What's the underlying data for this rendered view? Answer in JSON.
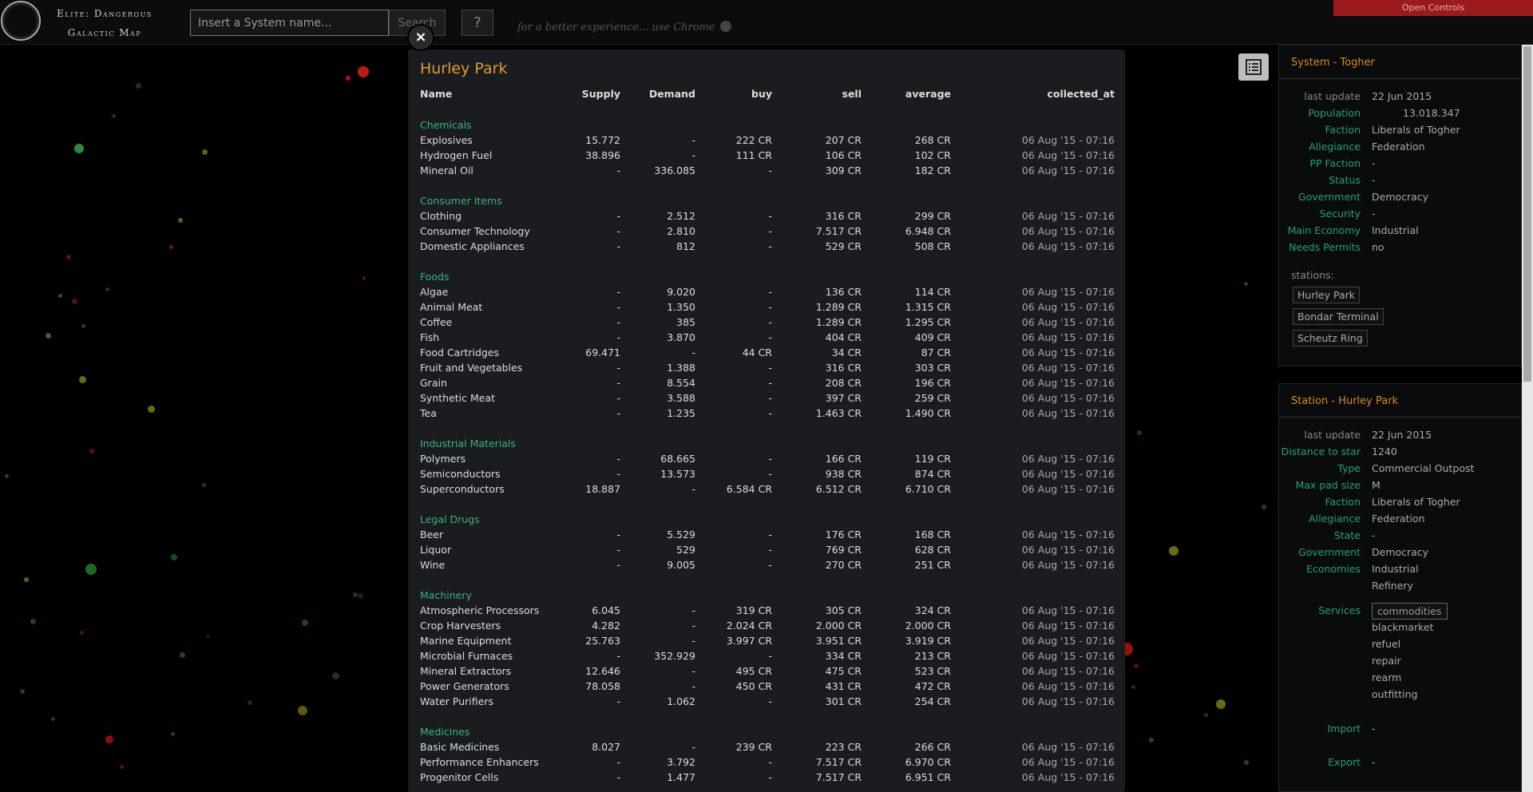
{
  "app": {
    "title_line1": "Elite: Dangerous",
    "title_line2": "Galactic Map"
  },
  "search": {
    "placeholder": "Insert a System name...",
    "button": "Search"
  },
  "help": {
    "label": "?"
  },
  "hint": {
    "text": "for a better experience... use Chrome"
  },
  "open_controls": "Open Controls",
  "close_label": "×",
  "market": {
    "station": "Hurley Park",
    "columns": [
      "Name",
      "Supply",
      "Demand",
      "buy",
      "sell",
      "average",
      "collected_at"
    ],
    "categories": [
      {
        "name": "Chemicals",
        "items": [
          [
            "Explosives",
            "15.772",
            "-",
            "222 CR",
            "207 CR",
            "268 CR",
            "06 Aug '15 - 07:16"
          ],
          [
            "Hydrogen Fuel",
            "38.896",
            "-",
            "111 CR",
            "106 CR",
            "102 CR",
            "06 Aug '15 - 07:16"
          ],
          [
            "Mineral Oil",
            "-",
            "336.085",
            "-",
            "309 CR",
            "182 CR",
            "06 Aug '15 - 07:16"
          ]
        ]
      },
      {
        "name": "Consumer Items",
        "items": [
          [
            "Clothing",
            "-",
            "2.512",
            "-",
            "316 CR",
            "299 CR",
            "06 Aug '15 - 07:16"
          ],
          [
            "Consumer Technology",
            "-",
            "2.810",
            "-",
            "7.517 CR",
            "6.948 CR",
            "06 Aug '15 - 07:16"
          ],
          [
            "Domestic Appliances",
            "-",
            "812",
            "-",
            "529 CR",
            "508 CR",
            "06 Aug '15 - 07:16"
          ]
        ]
      },
      {
        "name": "Foods",
        "items": [
          [
            "Algae",
            "-",
            "9.020",
            "-",
            "136 CR",
            "114 CR",
            "06 Aug '15 - 07:16"
          ],
          [
            "Animal Meat",
            "-",
            "1.350",
            "-",
            "1.289 CR",
            "1.315 CR",
            "06 Aug '15 - 07:16"
          ],
          [
            "Coffee",
            "-",
            "385",
            "-",
            "1.289 CR",
            "1.295 CR",
            "06 Aug '15 - 07:16"
          ],
          [
            "Fish",
            "-",
            "3.870",
            "-",
            "404 CR",
            "409 CR",
            "06 Aug '15 - 07:16"
          ],
          [
            "Food Cartridges",
            "69.471",
            "-",
            "44 CR",
            "34 CR",
            "87 CR",
            "06 Aug '15 - 07:16"
          ],
          [
            "Fruit and Vegetables",
            "-",
            "1.388",
            "-",
            "316 CR",
            "303 CR",
            "06 Aug '15 - 07:16"
          ],
          [
            "Grain",
            "-",
            "8.554",
            "-",
            "208 CR",
            "196 CR",
            "06 Aug '15 - 07:16"
          ],
          [
            "Synthetic Meat",
            "-",
            "3.588",
            "-",
            "397 CR",
            "259 CR",
            "06 Aug '15 - 07:16"
          ],
          [
            "Tea",
            "-",
            "1.235",
            "-",
            "1.463 CR",
            "1.490 CR",
            "06 Aug '15 - 07:16"
          ]
        ]
      },
      {
        "name": "Industrial Materials",
        "items": [
          [
            "Polymers",
            "-",
            "68.665",
            "-",
            "166 CR",
            "119 CR",
            "06 Aug '15 - 07:16"
          ],
          [
            "Semiconductors",
            "-",
            "13.573",
            "-",
            "938 CR",
            "874 CR",
            "06 Aug '15 - 07:16"
          ],
          [
            "Superconductors",
            "18.887",
            "-",
            "6.584 CR",
            "6.512 CR",
            "6.710 CR",
            "06 Aug '15 - 07:16"
          ]
        ]
      },
      {
        "name": "Legal Drugs",
        "items": [
          [
            "Beer",
            "-",
            "5.529",
            "-",
            "176 CR",
            "168 CR",
            "06 Aug '15 - 07:16"
          ],
          [
            "Liquor",
            "-",
            "529",
            "-",
            "769 CR",
            "628 CR",
            "06 Aug '15 - 07:16"
          ],
          [
            "Wine",
            "-",
            "9.005",
            "-",
            "270 CR",
            "251 CR",
            "06 Aug '15 - 07:16"
          ]
        ]
      },
      {
        "name": "Machinery",
        "items": [
          [
            "Atmospheric Processors",
            "6.045",
            "-",
            "319 CR",
            "305 CR",
            "324 CR",
            "06 Aug '15 - 07:16"
          ],
          [
            "Crop Harvesters",
            "4.282",
            "-",
            "2.024 CR",
            "2.000 CR",
            "2.000 CR",
            "06 Aug '15 - 07:16"
          ],
          [
            "Marine Equipment",
            "25.763",
            "-",
            "3.997 CR",
            "3.951 CR",
            "3.919 CR",
            "06 Aug '15 - 07:16"
          ],
          [
            "Microbial Furnaces",
            "-",
            "352.929",
            "-",
            "334 CR",
            "213 CR",
            "06 Aug '15 - 07:16"
          ],
          [
            "Mineral Extractors",
            "12.646",
            "-",
            "495 CR",
            "475 CR",
            "523 CR",
            "06 Aug '15 - 07:16"
          ],
          [
            "Power Generators",
            "78.058",
            "-",
            "450 CR",
            "431 CR",
            "472 CR",
            "06 Aug '15 - 07:16"
          ],
          [
            "Water Purifiers",
            "-",
            "1.062",
            "-",
            "301 CR",
            "254 CR",
            "06 Aug '15 - 07:16"
          ]
        ]
      },
      {
        "name": "Medicines",
        "items": [
          [
            "Basic Medicines",
            "8.027",
            "-",
            "239 CR",
            "223 CR",
            "266 CR",
            "06 Aug '15 - 07:16"
          ],
          [
            "Performance Enhancers",
            "-",
            "3.792",
            "-",
            "7.517 CR",
            "6.970 CR",
            "06 Aug '15 - 07:16"
          ],
          [
            "Progenitor Cells",
            "-",
            "1.477",
            "-",
            "7.517 CR",
            "6.951 CR",
            "06 Aug '15 - 07:16"
          ]
        ]
      }
    ]
  },
  "system_panel": {
    "title": "System - Togher",
    "rows": [
      {
        "label": "last update",
        "value": "22 Jun 2015",
        "gray": true
      },
      {
        "label": "Population",
        "value": "13.018.347",
        "indent": true
      },
      {
        "label": "Faction",
        "value": "Liberals of Togher"
      },
      {
        "label": "Allegiance",
        "value": "Federation"
      },
      {
        "label": "PP Faction",
        "value": "-"
      },
      {
        "label": "Status",
        "value": "-"
      },
      {
        "label": "Government",
        "value": "Democracy"
      },
      {
        "label": "Security",
        "value": "-"
      },
      {
        "label": "Main Economy",
        "value": "Industrial"
      },
      {
        "label": "Needs Permits",
        "value": "no"
      }
    ],
    "stations_label": "stations:",
    "stations": [
      "Hurley Park",
      "Bondar Terminal",
      "Scheutz Ring"
    ]
  },
  "station_panel": {
    "title": "Station - Hurley Park",
    "rows": [
      {
        "label": "last update",
        "value": "22 Jun 2015",
        "gray": true
      },
      {
        "label": "Distance to star",
        "value": "1240"
      },
      {
        "label": "Type",
        "value": "Commercial Outpost"
      },
      {
        "label": "Max pad size",
        "value": "M"
      },
      {
        "label": "Faction",
        "value": "Liberals of Togher"
      },
      {
        "label": "Allegiance",
        "value": "Federation"
      },
      {
        "label": "State",
        "value": "-"
      },
      {
        "label": "Government",
        "value": "Democracy"
      },
      {
        "label": "Economies",
        "value": "Industrial"
      },
      {
        "label": "",
        "value": "Refinery"
      }
    ],
    "services_label": "Services",
    "services": [
      "commodities",
      "blackmarket",
      "refuel",
      "repair",
      "rearm",
      "outfitting"
    ],
    "import_label": "Import",
    "import_value": "-",
    "export_label": "Export",
    "export_value": "-"
  },
  "colors": {
    "accent": "#e19a2b",
    "category": "#3bb37c",
    "label": "#1fa27a",
    "button_red": "#9b1a1a"
  }
}
